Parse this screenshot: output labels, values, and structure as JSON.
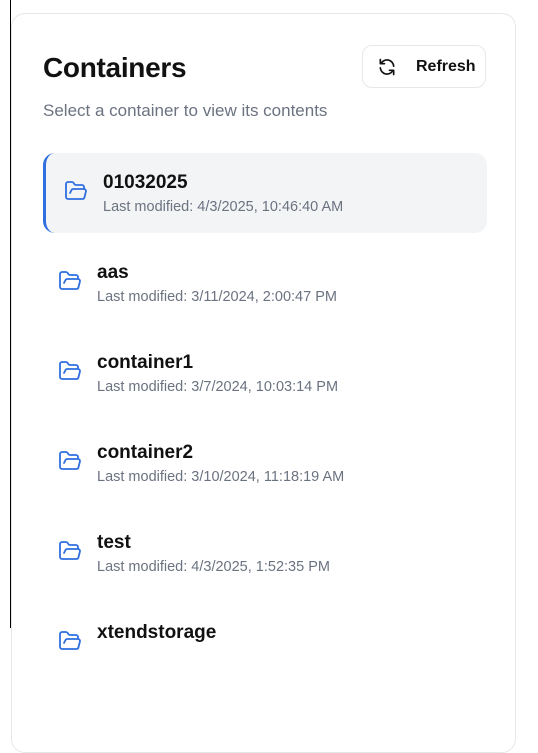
{
  "header": {
    "title": "Containers",
    "subtitle": "Select a container to view its contents",
    "refresh_label": "Refresh",
    "refresh_icon": "refresh-icon"
  },
  "colors": {
    "accent": "#2f6fe0",
    "selected_bg": "#f3f4f6",
    "muted_text": "#6b7280"
  },
  "containers": [
    {
      "name": "01032025",
      "modified": "Last modified: 4/3/2025, 10:46:40 AM",
      "selected": true,
      "icon": "folder-open-icon"
    },
    {
      "name": "aas",
      "modified": "Last modified: 3/11/2024, 2:00:47 PM",
      "selected": false,
      "icon": "folder-open-icon"
    },
    {
      "name": "container1",
      "modified": "Last modified: 3/7/2024, 10:03:14 PM",
      "selected": false,
      "icon": "folder-open-icon"
    },
    {
      "name": "container2",
      "modified": "Last modified: 3/10/2024, 11:18:19 AM",
      "selected": false,
      "icon": "folder-open-icon"
    },
    {
      "name": "test",
      "modified": "Last modified: 4/3/2025, 1:52:35 PM",
      "selected": false,
      "icon": "folder-open-icon"
    },
    {
      "name": "xtendstorage",
      "modified": "",
      "selected": false,
      "icon": "folder-open-icon"
    }
  ]
}
